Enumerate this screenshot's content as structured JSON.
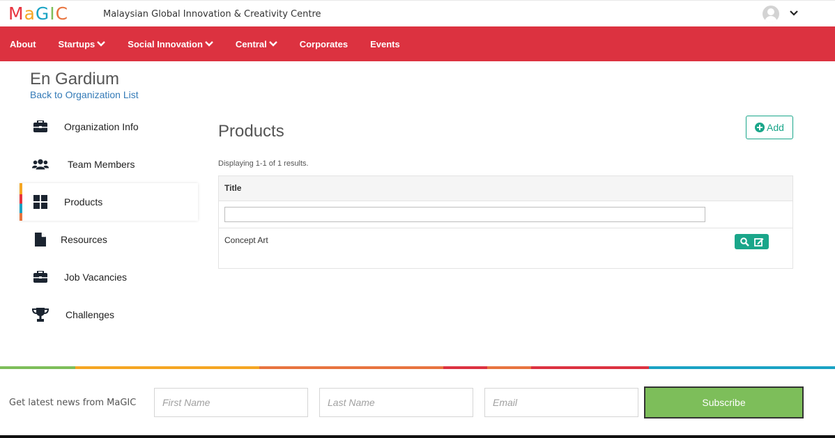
{
  "brand": {
    "logo_letters": [
      "M",
      "a",
      "G",
      "I",
      "C"
    ],
    "logo_colors": [
      "#e8343f",
      "#f5a623",
      "#1aa3c4",
      "#7dbe5a",
      "#e8343f"
    ],
    "tagline": "Malaysian Global Innovation & Creativity Centre"
  },
  "header": {
    "user_menu_icon": "user-avatar-icon",
    "caret_icon": "chevron-down-icon"
  },
  "nav": {
    "background": "#dc3240",
    "items": [
      {
        "label": "About",
        "dropdown": false
      },
      {
        "label": "Startups",
        "dropdown": true
      },
      {
        "label": "Social Innovation",
        "dropdown": true
      },
      {
        "label": "Central",
        "dropdown": true
      },
      {
        "label": "Corporates",
        "dropdown": false
      },
      {
        "label": "Events",
        "dropdown": false
      }
    ]
  },
  "organization": {
    "name": "En Gardium",
    "back_link": "Back to Organization List"
  },
  "sidebar": {
    "items": [
      {
        "label": "Organization Info",
        "icon": "briefcase-icon",
        "active": false
      },
      {
        "label": "Team Members",
        "icon": "users-icon",
        "active": false
      },
      {
        "label": "Products",
        "icon": "grid-icon",
        "active": true
      },
      {
        "label": "Resources",
        "icon": "file-icon",
        "active": false
      },
      {
        "label": "Job Vacancies",
        "icon": "briefcase-icon",
        "active": false
      },
      {
        "label": "Challenges",
        "icon": "trophy-icon",
        "active": false
      }
    ],
    "active_stripe_colors": [
      "#f5a623",
      "#e8343f",
      "#1aa3c4",
      "#e8343f"
    ]
  },
  "main": {
    "title": "Products",
    "add_label": "Add",
    "summary": "Displaying 1-1 of 1 results.",
    "table": {
      "columns": [
        "Title"
      ],
      "filter_value": "",
      "rows": [
        {
          "title": "Concept Art",
          "actions": [
            "search-icon",
            "edit-icon"
          ]
        }
      ]
    },
    "accent": "#1aa68a"
  },
  "footer": {
    "newsletter_label": "Get latest news from MaGIC",
    "first_name_placeholder": "First Name",
    "last_name_placeholder": "Last Name",
    "email_placeholder": "Email",
    "subscribe_label": "Subscribe",
    "subscribe_color": "#7dbe5a",
    "strip_colors": [
      "#7dbe5a",
      "#f5a623",
      "#e8743f",
      "#dc3240",
      "#e8743f",
      "#dc3240",
      "#1aa3c4"
    ]
  }
}
